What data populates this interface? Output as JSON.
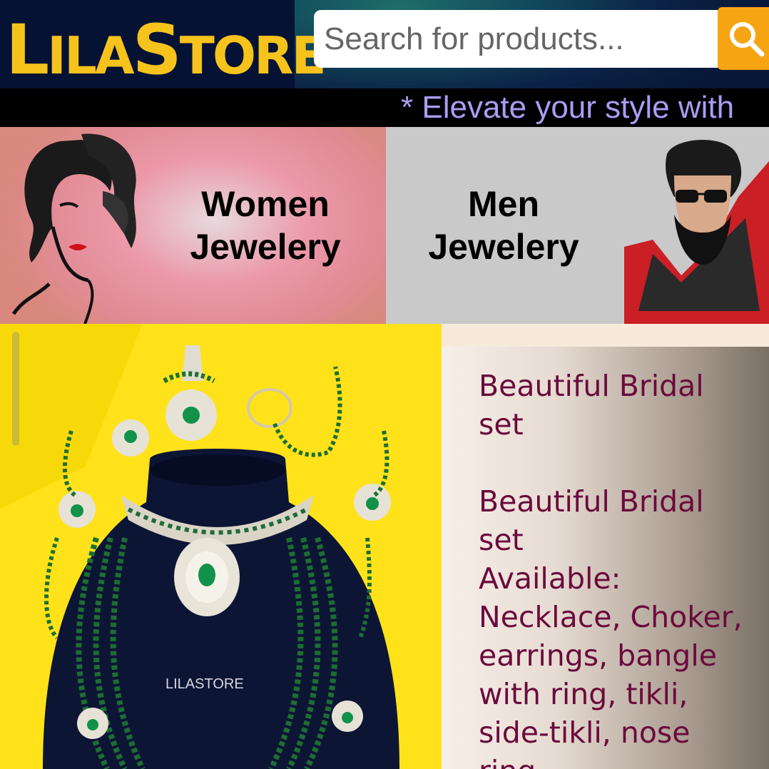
{
  "header": {
    "logo_part1": "L",
    "logo_part2": "ILA",
    "logo_part3": "S",
    "logo_part4": "TORE",
    "search_placeholder": "Search for products...",
    "search_icon": "search-icon"
  },
  "marquee": {
    "text": "* Elevate your style with"
  },
  "categories": [
    {
      "label": "Women Jewelery",
      "icon": "woman-face-icon"
    },
    {
      "label": "Men Jewelery",
      "icon": "bearded-man-icon"
    }
  ],
  "product": {
    "image_watermark": "LILASTORE",
    "title": "Beautiful Bridal set",
    "description": "Beautiful Bridal set\nAvailable: Necklace, Choker, earrings, bangle with ring, tikli, side-tikli, nose ring"
  },
  "colors": {
    "brand_yellow": "#f6c21c",
    "search_orange": "#f7a412",
    "marquee_text": "#a99df4",
    "product_text": "#6b0a3c"
  }
}
